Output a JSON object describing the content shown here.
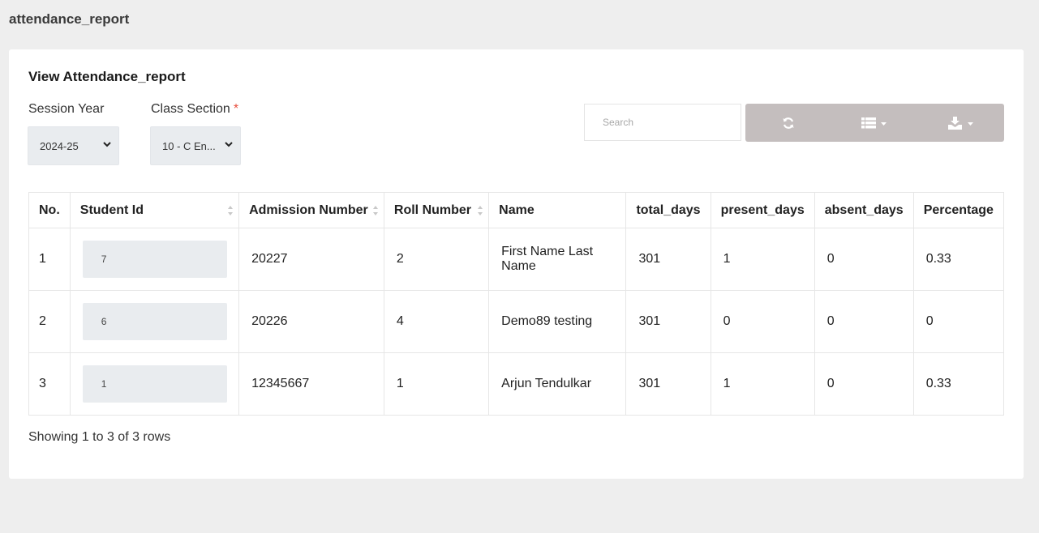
{
  "page": {
    "title": "attendance_report"
  },
  "card": {
    "title": "View Attendance_report"
  },
  "filters": {
    "session_label": "Session Year",
    "session_value": "2024-25",
    "class_label": "Class Section",
    "class_required_mark": "*",
    "class_value": "10 - C En..."
  },
  "search": {
    "placeholder": "Search"
  },
  "toolbar": {
    "buttons": [
      {
        "icon": "refresh-icon"
      },
      {
        "icon": "columns-icon"
      },
      {
        "icon": "export-icon"
      }
    ]
  },
  "table": {
    "headers": [
      "No.",
      "Student Id",
      "Admission Number",
      "Roll Number",
      "Name",
      "total_days",
      "present_days",
      "absent_days",
      "Percentage"
    ],
    "rows": [
      {
        "no": "1",
        "student_id": "7",
        "admission": "20227",
        "roll": "2",
        "name": "First Name Last Name",
        "total": "301",
        "present": "1",
        "absent": "0",
        "percentage": "0.33"
      },
      {
        "no": "2",
        "student_id": "6",
        "admission": "20226",
        "roll": "4",
        "name": "Demo89 testing",
        "total": "301",
        "present": "0",
        "absent": "0",
        "percentage": "0"
      },
      {
        "no": "3",
        "student_id": "1",
        "admission": "12345667",
        "roll": "1",
        "name": "Arjun Tendulkar",
        "total": "301",
        "present": "1",
        "absent": "0",
        "percentage": "0.33"
      }
    ]
  },
  "footer": {
    "text": "Showing 1 to 3 of 3 rows"
  },
  "colors": {
    "toolbar_bg": "#c4bebe",
    "required": "#e74c3c",
    "page_bg": "#eeeeee"
  }
}
